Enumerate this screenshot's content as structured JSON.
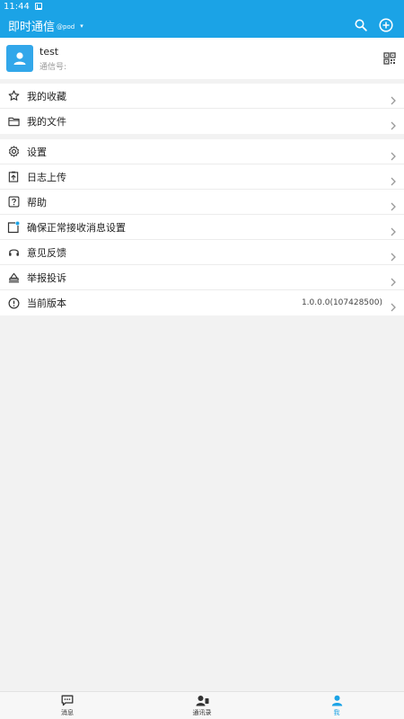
{
  "status_bar": {
    "time": "11:44"
  },
  "app_bar": {
    "title": "即时通信",
    "subtitle": "@pod",
    "caret": "▾",
    "icons": [
      "search-icon",
      "add-circle-icon"
    ]
  },
  "profile": {
    "name": "test",
    "id_label": "通信号:",
    "icons": [
      "avatar-person-icon",
      "qr-code-icon"
    ]
  },
  "menu_group_1": [
    {
      "label": "我的收藏",
      "icon": "star-icon"
    },
    {
      "label": "我的文件",
      "icon": "folder-icon"
    }
  ],
  "menu_group_2": [
    {
      "label": "设置",
      "icon": "gear-icon"
    },
    {
      "label": "日志上传",
      "icon": "upload-icon"
    },
    {
      "label": "帮助",
      "icon": "help-icon"
    },
    {
      "label": "确保正常接收消息设置",
      "icon": "notification-settings-icon"
    },
    {
      "label": "意见反馈",
      "icon": "headset-icon"
    },
    {
      "label": "举报投诉",
      "icon": "report-icon"
    },
    {
      "label": "当前版本",
      "icon": "info-icon",
      "value": "1.0.0.0(107428500)"
    }
  ],
  "bottom_nav": [
    {
      "label": "消息",
      "icon": "message-icon",
      "active": false
    },
    {
      "label": "通讯录",
      "icon": "contacts-icon",
      "active": false
    },
    {
      "label": "我",
      "icon": "person-icon",
      "active": true
    }
  ],
  "colors": {
    "accent": "#1ba3e6",
    "background": "#f2f2f2"
  }
}
